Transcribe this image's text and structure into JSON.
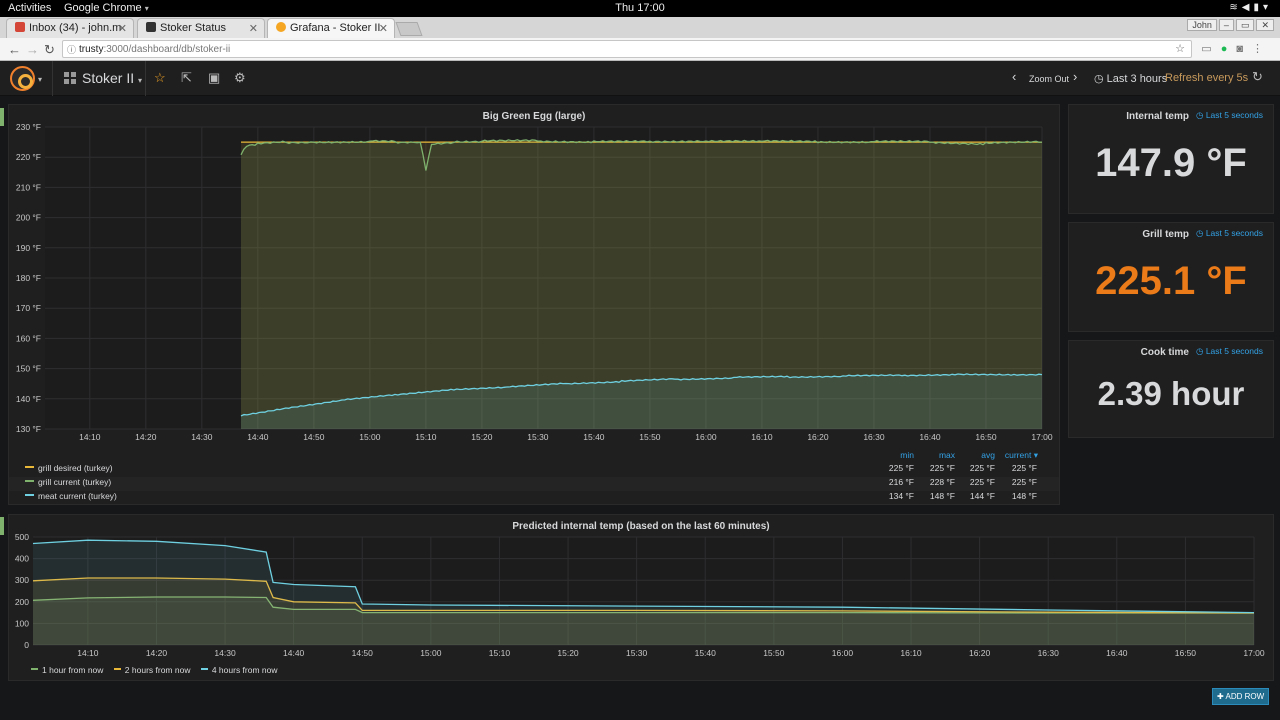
{
  "os": {
    "activities": "Activities",
    "app_name": "Google Chrome",
    "clock": "Thu 17:00"
  },
  "browser": {
    "tabs": [
      {
        "label": "Inbox (34) - john.m",
        "icon_color": "#d44638"
      },
      {
        "label": "Stoker Status",
        "icon_color": "#333333"
      },
      {
        "label": "Grafana - Stoker II",
        "icon_color": "#f5a623"
      }
    ],
    "profile": "John",
    "url_host": "trusty",
    "url_path": ":3000/dashboard/db/stoker-ii"
  },
  "grafana": {
    "dashboard_title": "Stoker II",
    "zoom_out": "Zoom Out",
    "time_range": "Last 3 hours",
    "refresh": "Refresh every 5s",
    "add_row": "ADD ROW"
  },
  "panels": {
    "main": {
      "title": "Big Green Egg (large)",
      "legend": {
        "headers": [
          "min",
          "max",
          "avg",
          "current"
        ],
        "rows": [
          {
            "name": "grill desired (turkey)",
            "color": "#eab839",
            "min": "225 °F",
            "max": "225 °F",
            "avg": "225 °F",
            "current": "225 °F"
          },
          {
            "name": "grill current (turkey)",
            "color": "#7eb26d",
            "min": "216 °F",
            "max": "228 °F",
            "avg": "225 °F",
            "current": "225 °F"
          },
          {
            "name": "meat current (turkey)",
            "color": "#6ed0e0",
            "min": "134 °F",
            "max": "148 °F",
            "avg": "144 °F",
            "current": "148 °F"
          }
        ]
      }
    },
    "internal": {
      "title": "Internal temp",
      "range": "Last 5 seconds",
      "value": "147.9 °F",
      "color": "#d8d9da"
    },
    "grill": {
      "title": "Grill temp",
      "range": "Last 5 seconds",
      "value": "225.1 °F",
      "color": "#eb7b18"
    },
    "cook": {
      "title": "Cook time",
      "range": "Last 5 seconds",
      "value": "2.39 hour",
      "color": "#d8d9da"
    },
    "predicted": {
      "title": "Predicted internal temp (based on the last 60 minutes)",
      "legend": [
        {
          "name": "1 hour from now",
          "color": "#7eb26d"
        },
        {
          "name": "2 hours from now",
          "color": "#eab839"
        },
        {
          "name": "4 hours from now",
          "color": "#6ed0e0"
        }
      ]
    }
  },
  "chart_data": [
    {
      "type": "line",
      "title": "Big Green Egg (large)",
      "x_ticks": [
        "14:10",
        "14:20",
        "14:30",
        "14:40",
        "14:50",
        "15:00",
        "15:10",
        "15:20",
        "15:30",
        "15:40",
        "15:50",
        "16:00",
        "16:10",
        "16:20",
        "16:30",
        "16:40",
        "16:50",
        "17:00"
      ],
      "y_ticks": [
        "130 °F",
        "140 °F",
        "150 °F",
        "160 °F",
        "170 °F",
        "180 °F",
        "190 °F",
        "200 °F",
        "210 °F",
        "220 °F",
        "230 °F"
      ],
      "ylim": [
        130,
        230
      ],
      "xlim": [
        "14:02",
        "17:00"
      ],
      "grid": true,
      "series": [
        {
          "name": "grill desired (turkey)",
          "color": "#eab839",
          "x": [
            "14:37",
            "17:00"
          ],
          "values": [
            225,
            225
          ]
        },
        {
          "name": "grill current (turkey)",
          "color": "#7eb26d",
          "x": [
            "14:37",
            "14:38",
            "14:40",
            "14:45",
            "14:50",
            "15:00",
            "15:05",
            "15:09",
            "15:10",
            "15:11",
            "15:15",
            "15:20",
            "15:30",
            "15:40",
            "15:50",
            "16:00",
            "16:10",
            "16:20",
            "16:30",
            "16:40",
            "16:50",
            "17:00"
          ],
          "values": [
            221,
            224,
            224.5,
            225,
            225,
            225.3,
            225,
            225,
            216,
            224.5,
            225,
            225.2,
            225.5,
            225,
            225.3,
            225.2,
            225.5,
            225,
            225.2,
            225,
            224.5,
            225
          ]
        },
        {
          "name": "meat current (turkey)",
          "color": "#6ed0e0",
          "x": [
            "14:37",
            "14:45",
            "14:55",
            "15:05",
            "15:15",
            "15:25",
            "15:35",
            "15:45",
            "15:55",
            "16:05",
            "16:15",
            "16:25",
            "16:35",
            "16:45",
            "16:55",
            "17:00"
          ],
          "values": [
            134.5,
            137,
            139.5,
            141.5,
            143,
            144,
            145,
            145.8,
            146.5,
            147,
            147.3,
            147.5,
            147.8,
            148,
            148,
            148
          ]
        }
      ]
    },
    {
      "type": "line",
      "title": "Predicted internal temp (based on the last 60 minutes)",
      "x_ticks": [
        "14:10",
        "14:20",
        "14:30",
        "14:40",
        "14:50",
        "15:00",
        "15:10",
        "15:20",
        "15:30",
        "15:40",
        "15:50",
        "16:00",
        "16:10",
        "16:20",
        "16:30",
        "16:40",
        "16:50",
        "17:00"
      ],
      "y_ticks": [
        "0",
        "100",
        "200",
        "300",
        "400",
        "500"
      ],
      "ylim": [
        0,
        500
      ],
      "xlim": [
        "14:02",
        "17:00"
      ],
      "grid": true,
      "series": [
        {
          "name": "1 hour from now",
          "color": "#7eb26d",
          "x": [
            "14:02",
            "14:10",
            "14:20",
            "14:30",
            "14:36",
            "14:37",
            "14:40",
            "14:49",
            "14:50",
            "15:00",
            "15:30",
            "16:00",
            "16:30",
            "17:00"
          ],
          "values": [
            207,
            218,
            222,
            222,
            220,
            175,
            165,
            165,
            150,
            150,
            150,
            150,
            148,
            148
          ]
        },
        {
          "name": "2 hours from now",
          "color": "#eab839",
          "x": [
            "14:02",
            "14:10",
            "14:20",
            "14:30",
            "14:36",
            "14:37",
            "14:40",
            "14:49",
            "14:50",
            "15:00",
            "15:30",
            "16:00",
            "16:30",
            "17:00"
          ],
          "values": [
            297,
            310,
            310,
            305,
            295,
            220,
            200,
            195,
            160,
            160,
            160,
            158,
            152,
            148
          ]
        },
        {
          "name": "4 hours from now",
          "color": "#6ed0e0",
          "x": [
            "14:02",
            "14:10",
            "14:20",
            "14:30",
            "14:36",
            "14:37",
            "14:40",
            "14:49",
            "14:50",
            "15:00",
            "15:30",
            "16:00",
            "16:30",
            "17:00"
          ],
          "values": [
            470,
            485,
            480,
            460,
            430,
            290,
            280,
            270,
            190,
            185,
            180,
            175,
            162,
            150
          ]
        }
      ]
    }
  ]
}
